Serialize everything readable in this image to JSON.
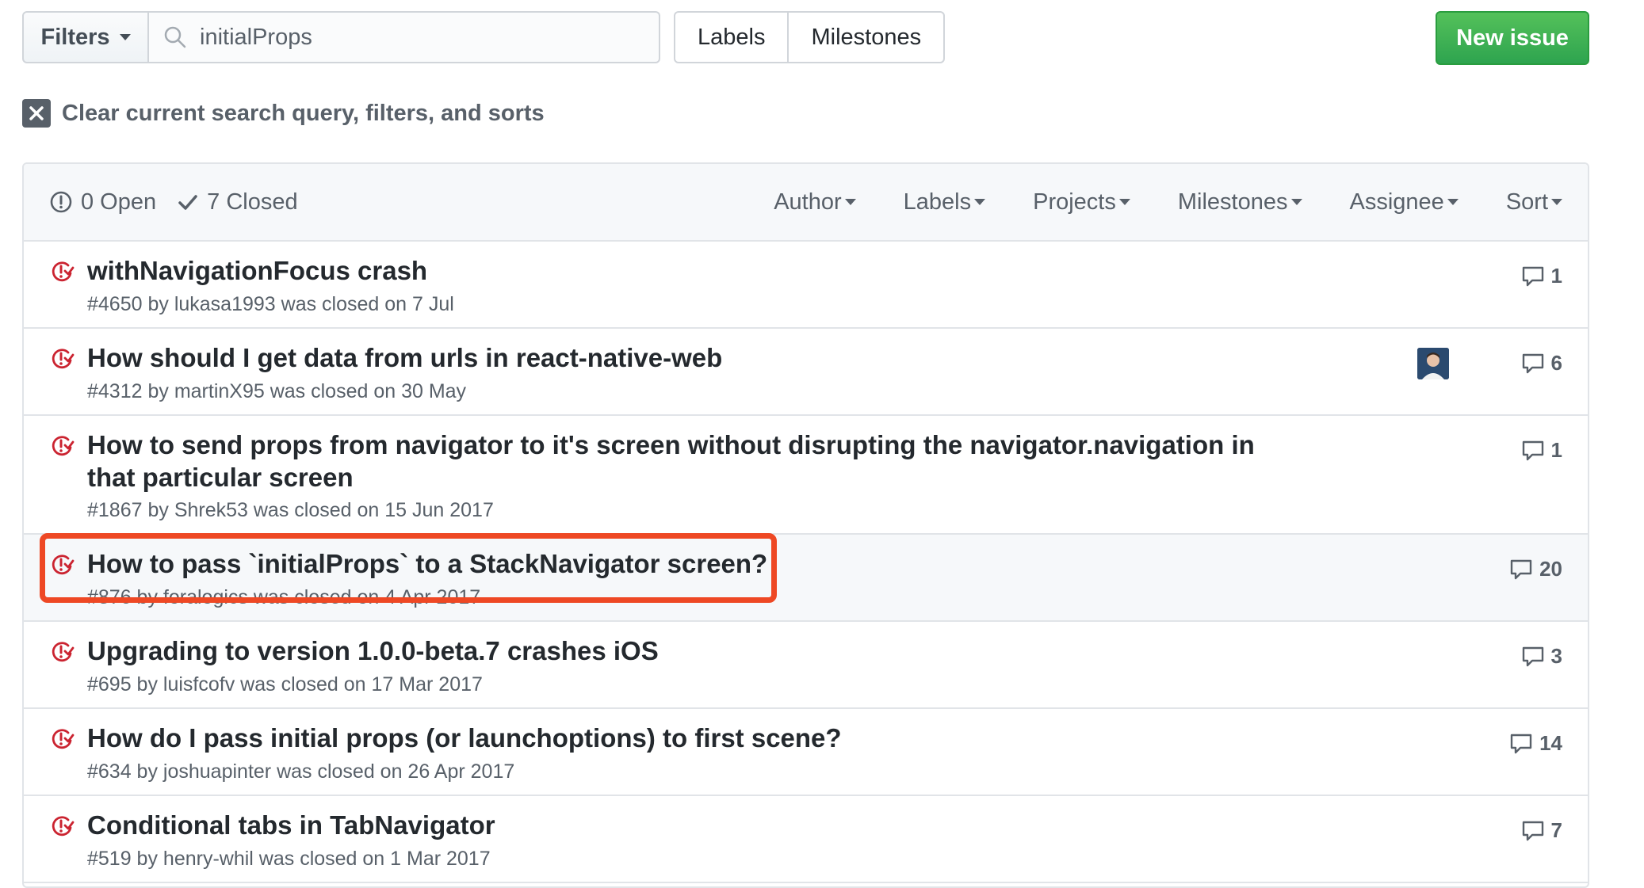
{
  "toolbar": {
    "filters_label": "Filters",
    "search_value": "initialProps",
    "labels_label": "Labels",
    "milestones_label": "Milestones",
    "new_issue_label": "New issue"
  },
  "clear_query_label": "Clear current search query, filters, and sorts",
  "header": {
    "open_label": "0 Open",
    "closed_label": "7 Closed",
    "sorters": [
      "Author",
      "Labels",
      "Projects",
      "Milestones",
      "Assignee",
      "Sort"
    ]
  },
  "issues": [
    {
      "title": "withNavigationFocus crash",
      "meta": "#4650 by lukasa1993 was closed on 7 Jul",
      "comments": "1"
    },
    {
      "title": "How should I get data from urls in react-native-web",
      "meta": "#4312 by martinX95 was closed on 30 May",
      "comments": "6"
    },
    {
      "title": "How to send props from navigator to it's screen without disrupting the navigator.navigation in that particular screen",
      "meta": "#1867 by Shrek53 was closed on 15 Jun 2017",
      "comments": "1"
    },
    {
      "title": "How to pass `initialProps` to a StackNavigator screen?",
      "meta": "#876 by foralogics was closed on 4 Apr 2017",
      "comments": "20"
    },
    {
      "title": "Upgrading to version 1.0.0-beta.7 crashes iOS",
      "meta": "#695 by luisfcofv was closed on 17 Mar 2017",
      "comments": "3"
    },
    {
      "title": "How do I pass initial props (or launchoptions) to first scene?",
      "meta": "#634 by joshuapinter was closed on 26 Apr 2017",
      "comments": "14"
    },
    {
      "title": "Conditional tabs in TabNavigator",
      "meta": "#519 by henry-whil was closed on 1 Mar 2017",
      "comments": "7"
    }
  ],
  "colors": {
    "closed_icon": "#cb2431",
    "new_issue_bg": "#2ea44f",
    "highlight_border": "#ee4824"
  }
}
